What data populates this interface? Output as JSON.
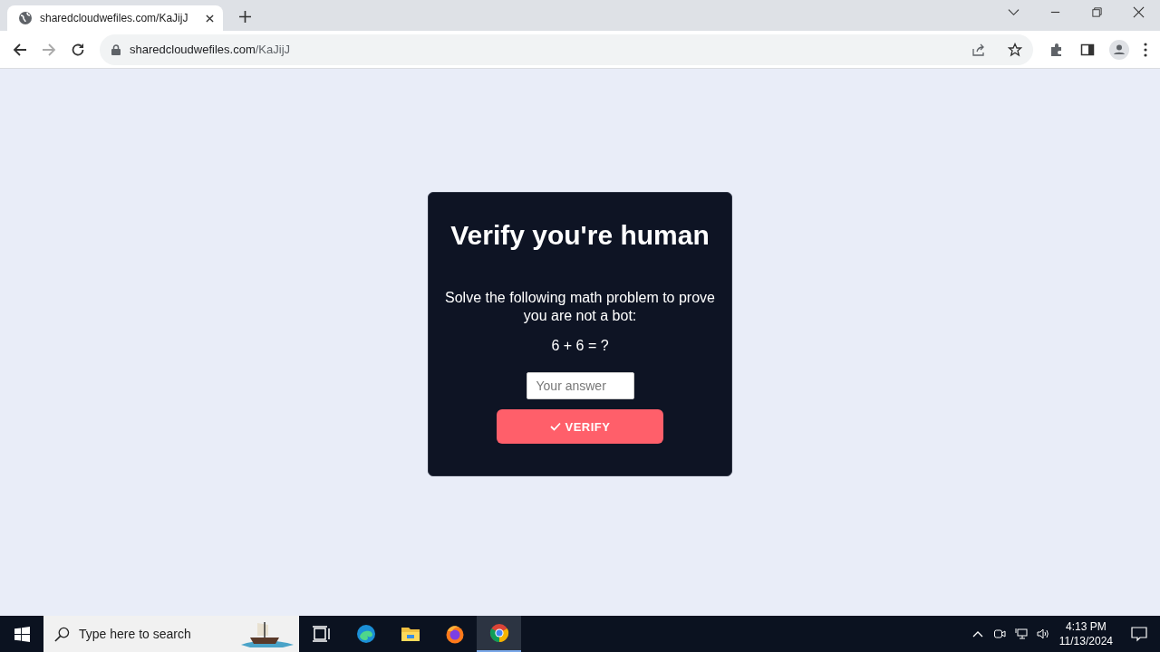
{
  "browser": {
    "tab_title": "sharedcloudwefiles.com/KaJijJ",
    "url_host": "sharedcloudwefiles.com",
    "url_path": "/KaJijJ"
  },
  "card": {
    "title": "Verify you're human",
    "message": "Solve the following math problem to prove you are not a bot:",
    "problem": "6 + 6 = ?",
    "answer_placeholder": "Your answer",
    "button": "VERIFY"
  },
  "taskbar": {
    "search_placeholder": "Type here to search",
    "apps": [
      {
        "kind": "taskview",
        "selected": false
      },
      {
        "kind": "edge",
        "selected": false
      },
      {
        "kind": "files",
        "selected": false
      },
      {
        "kind": "firefox",
        "selected": false
      },
      {
        "kind": "chrome",
        "selected": true
      }
    ],
    "time": "4:13 PM",
    "date": "11/13/2024"
  }
}
